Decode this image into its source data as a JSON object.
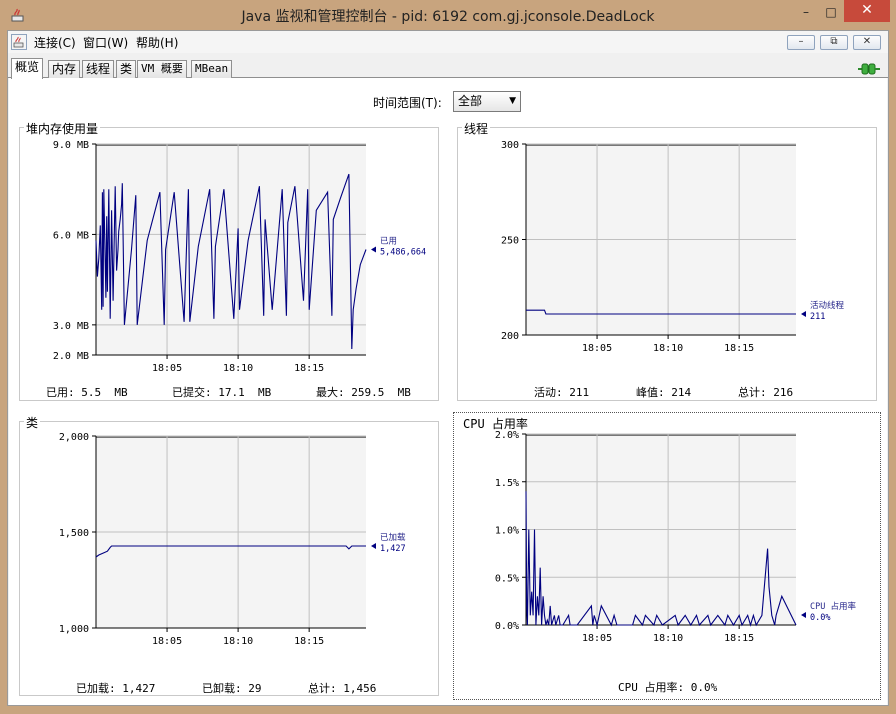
{
  "window": {
    "title": "Java 监视和管理控制台 - pid: 6192 com.gj.jconsole.DeadLock",
    "minimize": "–",
    "maximize": "□",
    "close": "✕"
  },
  "menubar": {
    "items": [
      "连接(C)",
      "窗口(W)",
      "帮助(H)"
    ],
    "mdi_buttons": [
      "–",
      "⧉",
      "✕"
    ]
  },
  "tabs": [
    "概览",
    "内存",
    "线程",
    "类",
    "VM 概要",
    "MBean"
  ],
  "time_range": {
    "label": "时间范围(T):",
    "selected": "全部"
  },
  "colors": {
    "line": "#000080",
    "grid": "#c0c0c0",
    "plot_bg": "#f4f4f4",
    "window_chrome": "#c8a47e"
  },
  "charts": {
    "heap": {
      "title": "堆内存使用量",
      "legend_label": "已用",
      "legend_value": "5,486,664",
      "summary": {
        "used_label": "已用:",
        "used": "5.5  MB",
        "committed_label": "已提交:",
        "committed": "17.1  MB",
        "max_label": "最大:",
        "max": "259.5  MB"
      }
    },
    "threads": {
      "title": "线程",
      "legend_label": "活动线程",
      "legend_value": "211",
      "summary": {
        "live_label": "活动:",
        "live": "211",
        "peak_label": "峰值:",
        "peak": "214",
        "total_label": "总计:",
        "total": "216"
      }
    },
    "classes": {
      "title": "类",
      "legend_label": "已加载",
      "legend_value": "1,427",
      "summary": {
        "loaded_label": "已加载:",
        "loaded": "1,427",
        "unloaded_label": "已卸载:",
        "unloaded": "29",
        "total_label": "总计:",
        "total": "1,456"
      }
    },
    "cpu": {
      "title": "CPU 占用率",
      "legend_label": "CPU 占用率",
      "legend_value": "0.0%",
      "summary": {
        "label": "CPU 占用率:",
        "value": "0.0%"
      }
    }
  },
  "chart_data": [
    {
      "type": "line",
      "title": "堆内存使用量",
      "x_ticks": [
        "18:05",
        "18:10",
        "18:15"
      ],
      "y_ticks": [
        "9.0 MB",
        "6.0 MB",
        "3.0 MB",
        "2.0 MB"
      ],
      "y_tick_values": [
        9.0,
        6.0,
        3.0,
        2.0
      ],
      "ylim": [
        2.0,
        9.0
      ],
      "xlim": [
        0,
        19
      ],
      "x_tick_values": [
        5,
        10,
        15
      ],
      "grid": true,
      "legend_position": "right",
      "series": [
        {
          "name": "已用",
          "x": [
            0,
            0.1,
            0.2,
            0.3,
            0.4,
            0.45,
            0.5,
            0.55,
            0.7,
            0.75,
            0.8,
            0.9,
            1.0,
            1.1,
            1.2,
            1.35,
            1.45,
            1.55,
            1.6,
            1.7,
            1.8,
            1.85,
            2.0,
            2.5,
            2.8,
            2.9,
            3.6,
            4.5,
            4.8,
            4.9,
            5.5,
            6.2,
            6.5,
            6.6,
            7.2,
            8.0,
            8.3,
            8.4,
            9.0,
            9.7,
            10.0,
            10.1,
            10.7,
            11.5,
            11.8,
            11.9,
            12.4,
            13.1,
            13.4,
            13.5,
            14.0,
            14.6,
            14.9,
            15.0,
            15.5,
            16.3,
            16.6,
            16.7,
            17.2,
            17.8,
            18.0,
            18.1,
            18.3,
            18.6,
            19.0
          ],
          "values": [
            5.8,
            4.6,
            5.2,
            6.3,
            3.5,
            7.4,
            3.6,
            7.5,
            3.9,
            6.6,
            4.1,
            7.5,
            3.2,
            6.8,
            3.8,
            7.6,
            4.8,
            5.5,
            6.1,
            6.5,
            7.0,
            7.7,
            3.0,
            5.5,
            7.3,
            3.0,
            5.8,
            7.4,
            3.0,
            5.5,
            7.4,
            3.1,
            7.5,
            3.1,
            5.6,
            7.5,
            3.2,
            5.6,
            7.5,
            3.2,
            6.2,
            3.5,
            5.8,
            7.6,
            3.3,
            6.5,
            3.5,
            7.5,
            3.3,
            6.4,
            7.6,
            3.8,
            7.5,
            3.5,
            6.8,
            7.4,
            3.3,
            6.5,
            7.2,
            8.0,
            2.2,
            3.5,
            4.2,
            5.0,
            5.5
          ]
        }
      ]
    },
    {
      "type": "line",
      "title": "线程",
      "x_ticks": [
        "18:05",
        "18:10",
        "18:15"
      ],
      "y_ticks": [
        "300",
        "250",
        "200"
      ],
      "y_tick_values": [
        300,
        250,
        200
      ],
      "ylim": [
        200,
        300
      ],
      "xlim": [
        0,
        19
      ],
      "x_tick_values": [
        5,
        10,
        15
      ],
      "grid": true,
      "legend_position": "right",
      "series": [
        {
          "name": "活动线程",
          "x": [
            0,
            1.3,
            1.4,
            19
          ],
          "values": [
            213,
            213,
            211,
            211
          ]
        }
      ]
    },
    {
      "type": "line",
      "title": "类",
      "x_ticks": [
        "18:05",
        "18:10",
        "18:15"
      ],
      "y_ticks": [
        "2,000",
        "1,500",
        "1,000"
      ],
      "y_tick_values": [
        2000,
        1500,
        1000
      ],
      "ylim": [
        1000,
        2000
      ],
      "xlim": [
        0,
        19
      ],
      "x_tick_values": [
        5,
        10,
        15
      ],
      "grid": true,
      "legend_position": "right",
      "series": [
        {
          "name": "已加载",
          "x": [
            0,
            0.2,
            0.5,
            0.8,
            1.0,
            1.1,
            17.6,
            17.8,
            18.0,
            19
          ],
          "values": [
            1370,
            1380,
            1390,
            1400,
            1420,
            1427,
            1427,
            1412,
            1427,
            1427
          ]
        }
      ]
    },
    {
      "type": "line",
      "title": "CPU 占用率",
      "x_ticks": [
        "18:05",
        "18:10",
        "18:15"
      ],
      "y_ticks": [
        "2.0%",
        "1.5%",
        "1.0%",
        "0.5%",
        "0.0%"
      ],
      "y_tick_values": [
        2.0,
        1.5,
        1.0,
        0.5,
        0.0
      ],
      "ylim": [
        0.0,
        2.0
      ],
      "xlim": [
        0,
        19
      ],
      "x_tick_values": [
        5,
        10,
        15
      ],
      "grid": true,
      "legend_position": "right",
      "series": [
        {
          "name": "CPU 占用率",
          "x": [
            0,
            0.05,
            0.1,
            0.2,
            0.3,
            0.4,
            0.5,
            0.6,
            0.7,
            0.8,
            0.9,
            1.0,
            1.1,
            1.2,
            1.3,
            1.4,
            1.5,
            1.6,
            1.7,
            1.8,
            2.0,
            2.1,
            2.3,
            2.4,
            2.6,
            3.0,
            3.1,
            3.2,
            3.6,
            4.6,
            4.7,
            4.8,
            5.0,
            5.3,
            6.0,
            6.2,
            6.4,
            7.5,
            7.7,
            8.2,
            8.4,
            9.0,
            9.2,
            9.6,
            10.5,
            10.7,
            11.2,
            11.6,
            12.0,
            12.2,
            12.8,
            13.0,
            13.5,
            14.0,
            14.2,
            14.6,
            15.0,
            15.2,
            15.6,
            15.8,
            16.0,
            16.2,
            16.6,
            17.0,
            17.1,
            17.3,
            17.5,
            17.6,
            18.0,
            19.0
          ],
          "values": [
            1.4,
            0.2,
            0.0,
            1.0,
            0.1,
            0.35,
            0.1,
            1.0,
            0.0,
            0.3,
            0.1,
            0.6,
            0.0,
            0.3,
            0.1,
            0.0,
            0.05,
            0.0,
            0.2,
            0.0,
            0.1,
            0.0,
            0.1,
            0.0,
            0.0,
            0.1,
            0.0,
            0.0,
            0.0,
            0.2,
            0.0,
            0.1,
            0.0,
            0.2,
            0.0,
            0.1,
            0.0,
            0.0,
            0.1,
            0.0,
            0.1,
            0.0,
            0.1,
            0.0,
            0.1,
            0.0,
            0.1,
            0.0,
            0.1,
            0.0,
            0.1,
            0.0,
            0.1,
            0.0,
            0.1,
            0.0,
            0.1,
            0.0,
            0.1,
            0.0,
            0.1,
            0.0,
            0.1,
            0.8,
            0.4,
            0.1,
            0.0,
            0.1,
            0.3,
            0.0
          ]
        }
      ]
    }
  ]
}
